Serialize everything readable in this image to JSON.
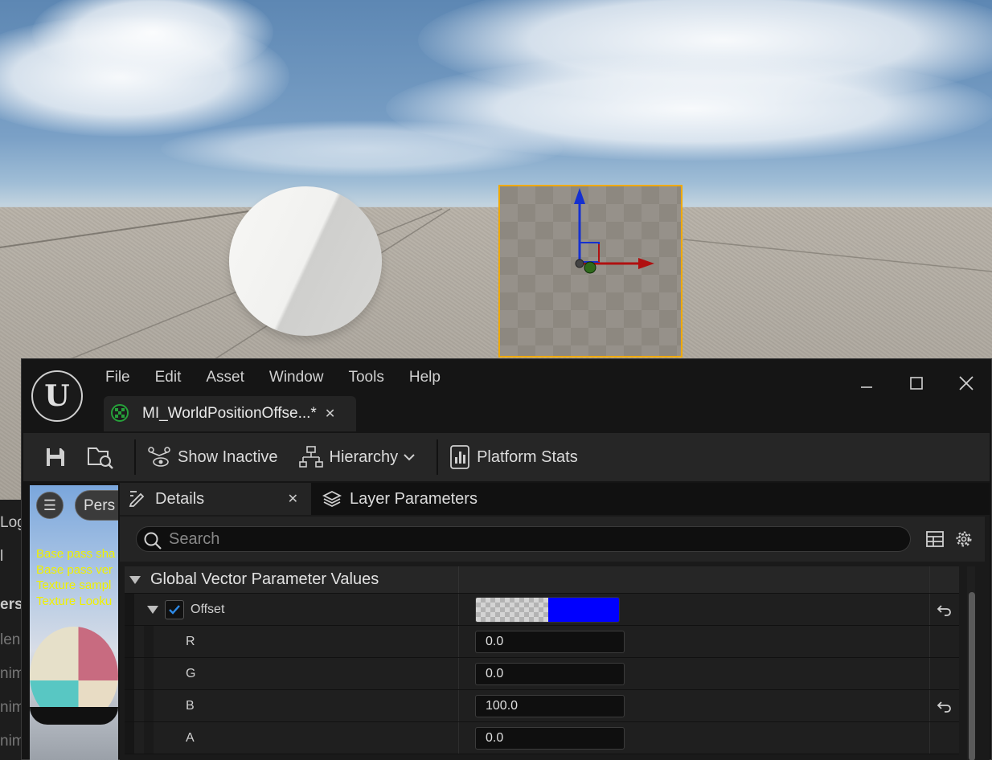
{
  "viewport": {
    "selected_actor_outline_color": "#f0a900"
  },
  "left_panel": {
    "partial_texts": [
      "Log",
      "l",
      "ers",
      "len",
      "nim",
      "nim",
      "nim"
    ]
  },
  "preview": {
    "view_mode_label": "Pers",
    "stats_lines": [
      "Base pass sha",
      "Base pass ver",
      "Texture sampl",
      "Texture Looku"
    ]
  },
  "editor": {
    "menu": [
      "File",
      "Edit",
      "Asset",
      "Window",
      "Tools",
      "Help"
    ],
    "document_tab": "MI_WorldPositionOffse...*",
    "toolbar": {
      "show_inactive": "Show Inactive",
      "hierarchy": "Hierarchy",
      "platform_stats": "Platform Stats"
    },
    "panel_tabs": {
      "details": "Details",
      "layer_parameters": "Layer Parameters"
    },
    "search": {
      "placeholder": "Search"
    },
    "group": {
      "label": "Global Vector Parameter Values"
    },
    "parameter": {
      "name": "Offset",
      "enabled": true,
      "swatch_color": "#0000ff",
      "channels": [
        {
          "label": "R",
          "value": "0.0",
          "modified": false
        },
        {
          "label": "G",
          "value": "0.0",
          "modified": false
        },
        {
          "label": "B",
          "value": "100.0",
          "modified": true
        },
        {
          "label": "A",
          "value": "0.0",
          "modified": false
        }
      ]
    },
    "accent_color": "#0078d4"
  }
}
